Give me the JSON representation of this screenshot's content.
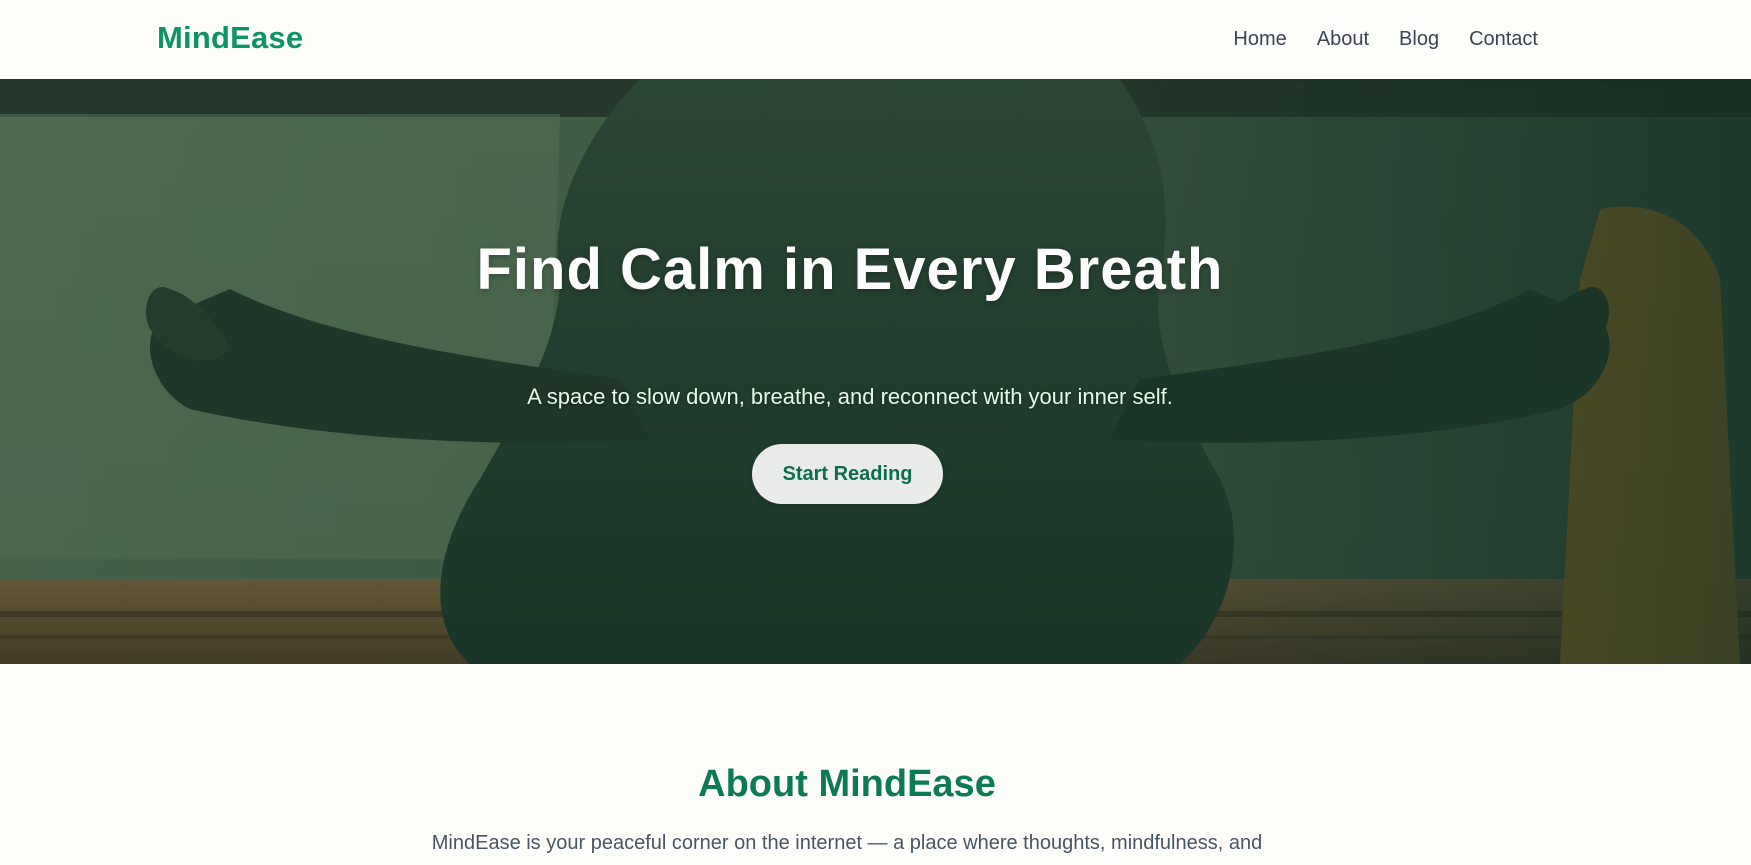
{
  "header": {
    "logo": "MindEase",
    "nav": [
      "Home",
      "About",
      "Blog",
      "Contact"
    ]
  },
  "hero": {
    "title": "Find Calm in Every Breath",
    "subtitle": "A space to slow down, breathe, and reconnect with your inner self.",
    "cta_label": "Start Reading",
    "image_description_icon": "meditation-photo"
  },
  "about": {
    "title": "About MindEase",
    "text": "MindEase is your peaceful corner on the internet — a place where thoughts, mindfulness, and"
  },
  "colors": {
    "brand": "#0e9268",
    "about_title": "#0c7a56",
    "nav_text": "#3a4656",
    "page_background": "#fdfdf9",
    "button_background": "#e9ece8",
    "button_text": "#0c6e4d"
  }
}
